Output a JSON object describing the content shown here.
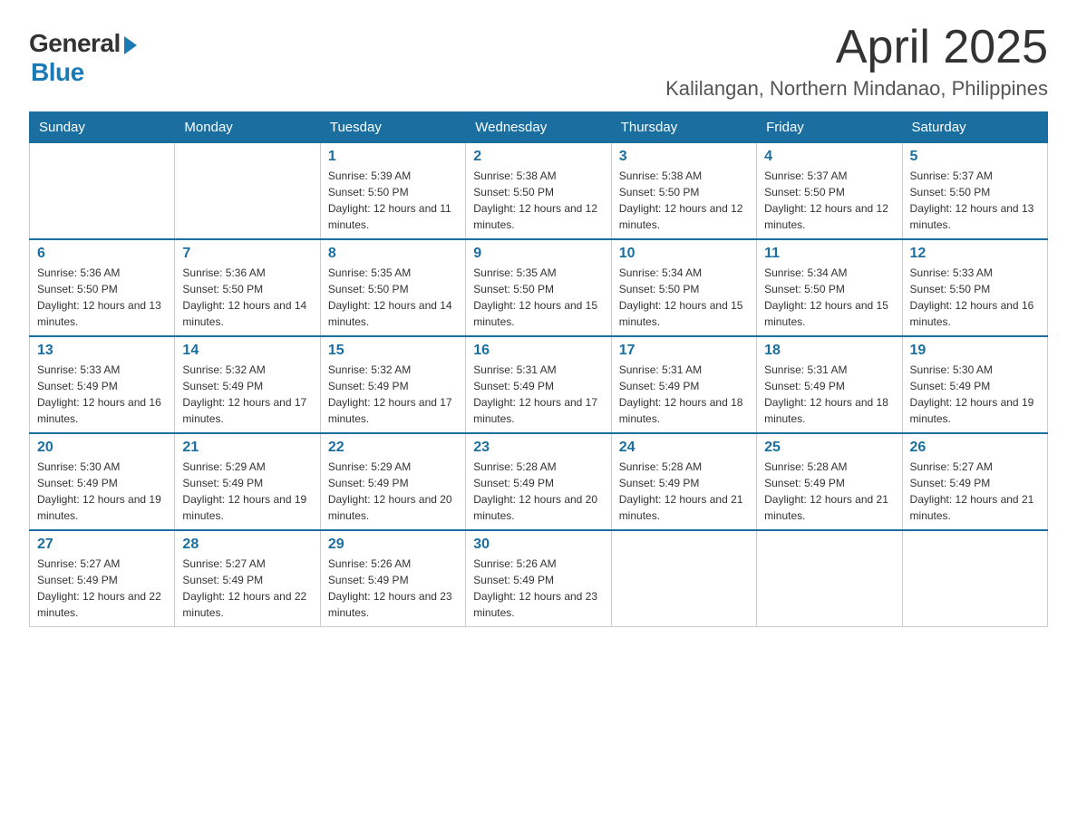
{
  "logo": {
    "general": "General",
    "blue": "Blue"
  },
  "title": "April 2025",
  "location": "Kalilangan, Northern Mindanao, Philippines",
  "days_header": [
    "Sunday",
    "Monday",
    "Tuesday",
    "Wednesday",
    "Thursday",
    "Friday",
    "Saturday"
  ],
  "weeks": [
    [
      {
        "day": "",
        "sunrise": "",
        "sunset": "",
        "daylight": ""
      },
      {
        "day": "",
        "sunrise": "",
        "sunset": "",
        "daylight": ""
      },
      {
        "day": "1",
        "sunrise": "Sunrise: 5:39 AM",
        "sunset": "Sunset: 5:50 PM",
        "daylight": "Daylight: 12 hours and 11 minutes."
      },
      {
        "day": "2",
        "sunrise": "Sunrise: 5:38 AM",
        "sunset": "Sunset: 5:50 PM",
        "daylight": "Daylight: 12 hours and 12 minutes."
      },
      {
        "day": "3",
        "sunrise": "Sunrise: 5:38 AM",
        "sunset": "Sunset: 5:50 PM",
        "daylight": "Daylight: 12 hours and 12 minutes."
      },
      {
        "day": "4",
        "sunrise": "Sunrise: 5:37 AM",
        "sunset": "Sunset: 5:50 PM",
        "daylight": "Daylight: 12 hours and 12 minutes."
      },
      {
        "day": "5",
        "sunrise": "Sunrise: 5:37 AM",
        "sunset": "Sunset: 5:50 PM",
        "daylight": "Daylight: 12 hours and 13 minutes."
      }
    ],
    [
      {
        "day": "6",
        "sunrise": "Sunrise: 5:36 AM",
        "sunset": "Sunset: 5:50 PM",
        "daylight": "Daylight: 12 hours and 13 minutes."
      },
      {
        "day": "7",
        "sunrise": "Sunrise: 5:36 AM",
        "sunset": "Sunset: 5:50 PM",
        "daylight": "Daylight: 12 hours and 14 minutes."
      },
      {
        "day": "8",
        "sunrise": "Sunrise: 5:35 AM",
        "sunset": "Sunset: 5:50 PM",
        "daylight": "Daylight: 12 hours and 14 minutes."
      },
      {
        "day": "9",
        "sunrise": "Sunrise: 5:35 AM",
        "sunset": "Sunset: 5:50 PM",
        "daylight": "Daylight: 12 hours and 15 minutes."
      },
      {
        "day": "10",
        "sunrise": "Sunrise: 5:34 AM",
        "sunset": "Sunset: 5:50 PM",
        "daylight": "Daylight: 12 hours and 15 minutes."
      },
      {
        "day": "11",
        "sunrise": "Sunrise: 5:34 AM",
        "sunset": "Sunset: 5:50 PM",
        "daylight": "Daylight: 12 hours and 15 minutes."
      },
      {
        "day": "12",
        "sunrise": "Sunrise: 5:33 AM",
        "sunset": "Sunset: 5:50 PM",
        "daylight": "Daylight: 12 hours and 16 minutes."
      }
    ],
    [
      {
        "day": "13",
        "sunrise": "Sunrise: 5:33 AM",
        "sunset": "Sunset: 5:49 PM",
        "daylight": "Daylight: 12 hours and 16 minutes."
      },
      {
        "day": "14",
        "sunrise": "Sunrise: 5:32 AM",
        "sunset": "Sunset: 5:49 PM",
        "daylight": "Daylight: 12 hours and 17 minutes."
      },
      {
        "day": "15",
        "sunrise": "Sunrise: 5:32 AM",
        "sunset": "Sunset: 5:49 PM",
        "daylight": "Daylight: 12 hours and 17 minutes."
      },
      {
        "day": "16",
        "sunrise": "Sunrise: 5:31 AM",
        "sunset": "Sunset: 5:49 PM",
        "daylight": "Daylight: 12 hours and 17 minutes."
      },
      {
        "day": "17",
        "sunrise": "Sunrise: 5:31 AM",
        "sunset": "Sunset: 5:49 PM",
        "daylight": "Daylight: 12 hours and 18 minutes."
      },
      {
        "day": "18",
        "sunrise": "Sunrise: 5:31 AM",
        "sunset": "Sunset: 5:49 PM",
        "daylight": "Daylight: 12 hours and 18 minutes."
      },
      {
        "day": "19",
        "sunrise": "Sunrise: 5:30 AM",
        "sunset": "Sunset: 5:49 PM",
        "daylight": "Daylight: 12 hours and 19 minutes."
      }
    ],
    [
      {
        "day": "20",
        "sunrise": "Sunrise: 5:30 AM",
        "sunset": "Sunset: 5:49 PM",
        "daylight": "Daylight: 12 hours and 19 minutes."
      },
      {
        "day": "21",
        "sunrise": "Sunrise: 5:29 AM",
        "sunset": "Sunset: 5:49 PM",
        "daylight": "Daylight: 12 hours and 19 minutes."
      },
      {
        "day": "22",
        "sunrise": "Sunrise: 5:29 AM",
        "sunset": "Sunset: 5:49 PM",
        "daylight": "Daylight: 12 hours and 20 minutes."
      },
      {
        "day": "23",
        "sunrise": "Sunrise: 5:28 AM",
        "sunset": "Sunset: 5:49 PM",
        "daylight": "Daylight: 12 hours and 20 minutes."
      },
      {
        "day": "24",
        "sunrise": "Sunrise: 5:28 AM",
        "sunset": "Sunset: 5:49 PM",
        "daylight": "Daylight: 12 hours and 21 minutes."
      },
      {
        "day": "25",
        "sunrise": "Sunrise: 5:28 AM",
        "sunset": "Sunset: 5:49 PM",
        "daylight": "Daylight: 12 hours and 21 minutes."
      },
      {
        "day": "26",
        "sunrise": "Sunrise: 5:27 AM",
        "sunset": "Sunset: 5:49 PM",
        "daylight": "Daylight: 12 hours and 21 minutes."
      }
    ],
    [
      {
        "day": "27",
        "sunrise": "Sunrise: 5:27 AM",
        "sunset": "Sunset: 5:49 PM",
        "daylight": "Daylight: 12 hours and 22 minutes."
      },
      {
        "day": "28",
        "sunrise": "Sunrise: 5:27 AM",
        "sunset": "Sunset: 5:49 PM",
        "daylight": "Daylight: 12 hours and 22 minutes."
      },
      {
        "day": "29",
        "sunrise": "Sunrise: 5:26 AM",
        "sunset": "Sunset: 5:49 PM",
        "daylight": "Daylight: 12 hours and 23 minutes."
      },
      {
        "day": "30",
        "sunrise": "Sunrise: 5:26 AM",
        "sunset": "Sunset: 5:49 PM",
        "daylight": "Daylight: 12 hours and 23 minutes."
      },
      {
        "day": "",
        "sunrise": "",
        "sunset": "",
        "daylight": ""
      },
      {
        "day": "",
        "sunrise": "",
        "sunset": "",
        "daylight": ""
      },
      {
        "day": "",
        "sunrise": "",
        "sunset": "",
        "daylight": ""
      }
    ]
  ]
}
